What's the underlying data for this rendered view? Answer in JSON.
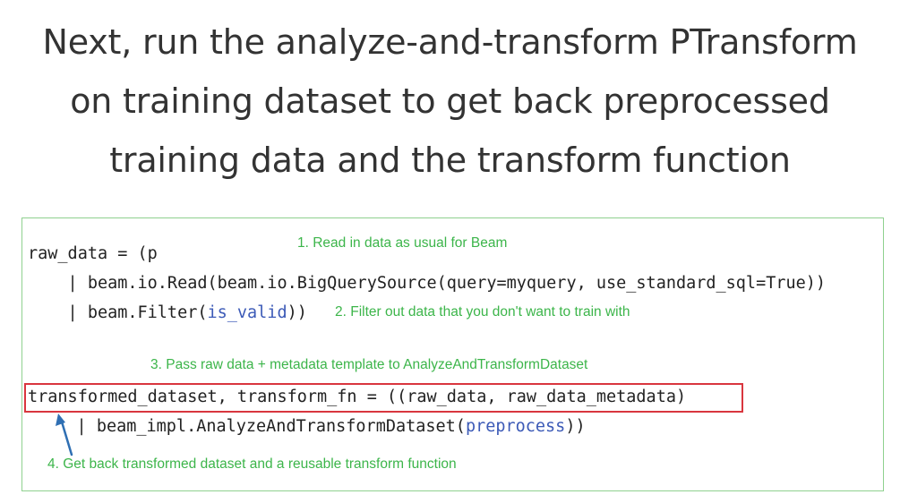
{
  "title": {
    "line1": "Next, run the analyze-and-transform PTransform",
    "line2": "on training dataset to get back preprocessed",
    "line3": "training data and the transform function"
  },
  "code": {
    "line1": "raw_data = (p",
    "line2": "    | beam.io.Read(beam.io.BigQuerySource(query=myquery, use_standard_sql=True))",
    "line3_pre": "    | beam.Filter(",
    "line3_arg": "is_valid",
    "line3_post": "))",
    "line4": "transformed_dataset, transform_fn = ((raw_data, raw_data_metadata)",
    "line5_pre": "    | beam_impl.AnalyzeAndTransformDataset(",
    "line5_arg": "preprocess",
    "line5_post": "))"
  },
  "notes": {
    "n1": "1. Read in data as usual for Beam",
    "n2": "2. Filter out data that you don't want to train with",
    "n3": "3. Pass raw data + metadata template to AnalyzeAndTransformDataset",
    "n4": "4. Get back transformed dataset and a reusable transform function"
  },
  "colors": {
    "note_green": "#3cb54a",
    "box_green": "#8fd18f",
    "highlight_red": "#d9363e",
    "arrow_blue": "#2f6fb3",
    "keyword_blue": "#3c5ab7"
  },
  "icons": {
    "arrow": "up-arrow-icon"
  }
}
